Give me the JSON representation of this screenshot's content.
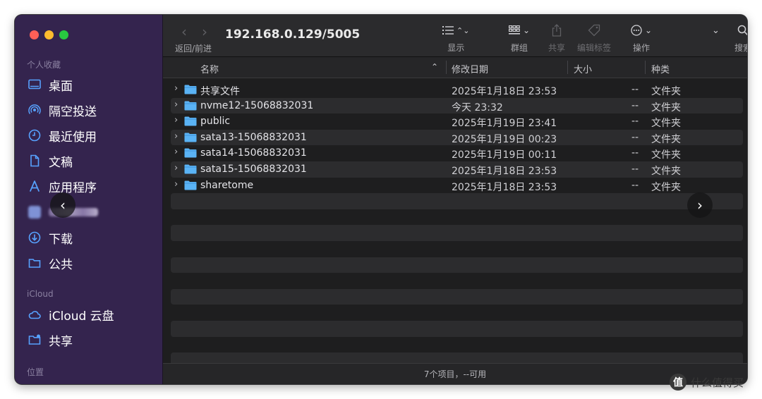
{
  "sidebar": {
    "favorites_title": "个人收藏",
    "favorites": [
      {
        "icon": "desktop-icon",
        "label": "桌面"
      },
      {
        "icon": "airdrop-icon",
        "label": "隔空投送"
      },
      {
        "icon": "recents-icon",
        "label": "最近使用"
      },
      {
        "icon": "document-icon",
        "label": "文稿"
      },
      {
        "icon": "applications-icon",
        "label": "应用程序"
      },
      {
        "icon": "home-icon",
        "label": ""
      },
      {
        "icon": "download-icon",
        "label": "下载"
      },
      {
        "icon": "public-folder-icon",
        "label": "公共"
      }
    ],
    "icloud_title": "iCloud",
    "icloud": [
      {
        "icon": "icloud-icon",
        "label": "iCloud 云盘"
      },
      {
        "icon": "shared-folder-icon",
        "label": "共享"
      }
    ],
    "locations_title": "位置"
  },
  "toolbar": {
    "path_title": "192.168.0.129/5005",
    "nav_label": "返回/前进",
    "view_label": "显示",
    "group_label": "群组",
    "share_label": "共享",
    "tags_label": "编辑标签",
    "action_label": "操作",
    "search_label": "搜索"
  },
  "columns": {
    "name": "名称",
    "date": "修改日期",
    "size": "大小",
    "kind": "种类"
  },
  "rows": [
    {
      "name": "共享文件",
      "date": "2025年1月18日 23:53",
      "size": "--",
      "kind": "文件夹"
    },
    {
      "name": "nvme12-15068832031",
      "date": "今天 23:32",
      "size": "--",
      "kind": "文件夹"
    },
    {
      "name": "public",
      "date": "2025年1月19日 23:41",
      "size": "--",
      "kind": "文件夹"
    },
    {
      "name": "sata13-15068832031",
      "date": "2025年1月19日 00:23",
      "size": "--",
      "kind": "文件夹"
    },
    {
      "name": "sata14-15068832031",
      "date": "2025年1月19日 00:11",
      "size": "--",
      "kind": "文件夹"
    },
    {
      "name": "sata15-15068832031",
      "date": "2025年1月18日 23:53",
      "size": "--",
      "kind": "文件夹"
    },
    {
      "name": "sharetome",
      "date": "2025年1月18日 23:53",
      "size": "--",
      "kind": "文件夹"
    }
  ],
  "status": "7个项目，--可用",
  "watermark": "什么值得买",
  "watermark_logo": "值",
  "colors": {
    "sidebar_bg": "#34244e",
    "accent_blue": "#57a2ff",
    "folder_blue": "#5ab3f5",
    "window_bg": "#1e1e1f"
  }
}
